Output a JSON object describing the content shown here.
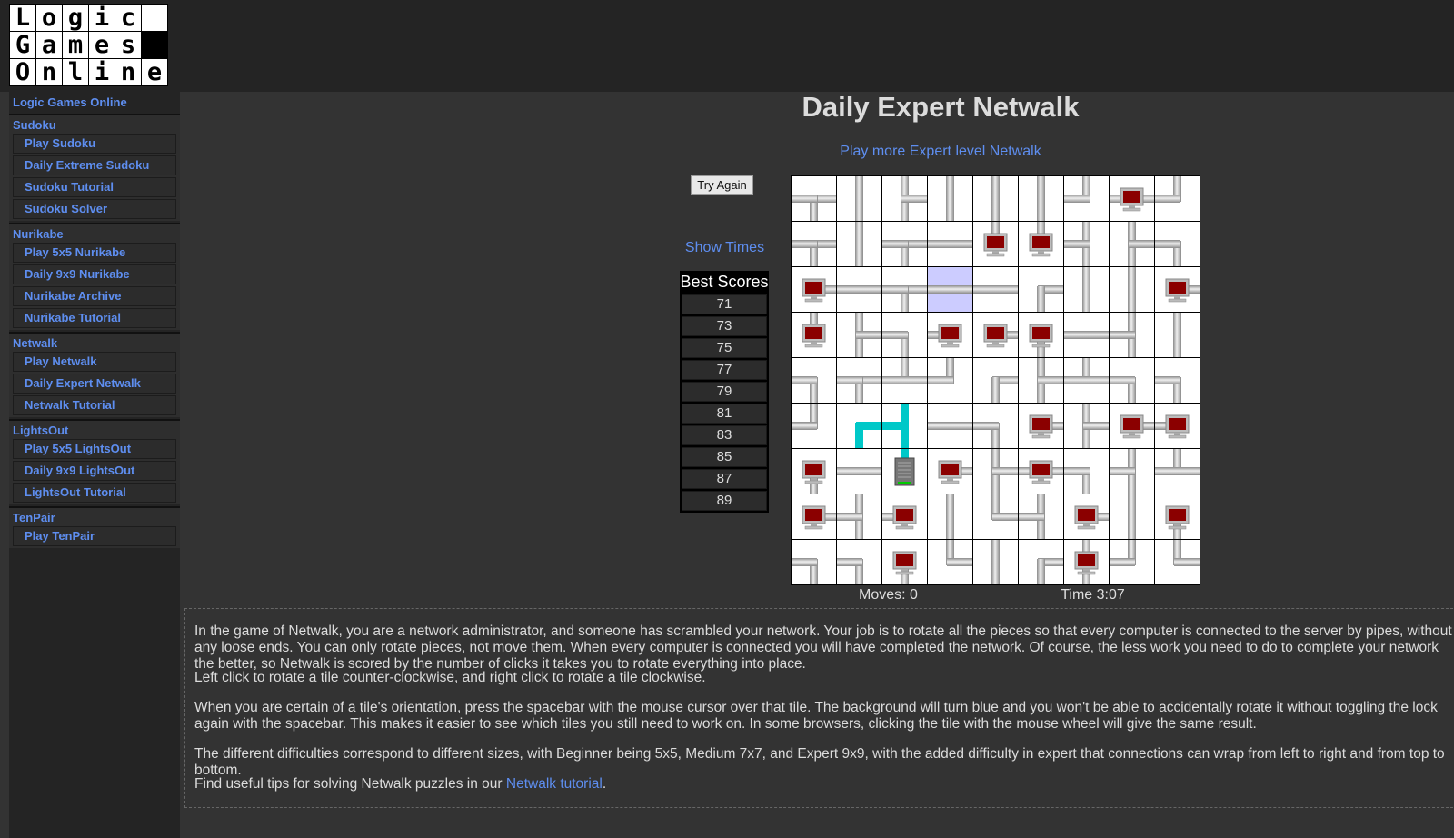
{
  "logo": {
    "rows": [
      [
        "L",
        "o",
        "g",
        "i",
        "c",
        ""
      ],
      [
        "G",
        "a",
        "m",
        "e",
        "s",
        ""
      ],
      [
        "O",
        "n",
        "l",
        "i",
        "n",
        "e"
      ]
    ]
  },
  "sidebar": {
    "home": "Logic Games Online",
    "groups": [
      {
        "title": "Sudoku",
        "items": [
          "Play Sudoku",
          "Daily Extreme Sudoku",
          "Sudoku Tutorial",
          "Sudoku Solver"
        ]
      },
      {
        "title": "Nurikabe",
        "items": [
          "Play 5x5 Nurikabe",
          "Daily 9x9 Nurikabe",
          "Nurikabe Archive",
          "Nurikabe Tutorial"
        ]
      },
      {
        "title": "Netwalk",
        "items": [
          "Play Netwalk",
          "Daily Expert Netwalk",
          "Netwalk Tutorial"
        ]
      },
      {
        "title": "LightsOut",
        "items": [
          "Play 5x5 LightsOut",
          "Daily 9x9 LightsOut",
          "LightsOut Tutorial"
        ]
      },
      {
        "title": "TenPair",
        "items": [
          "Play TenPair"
        ]
      }
    ]
  },
  "page": {
    "title": "Daily Expert Netwalk",
    "more_link": "Play more Expert level Netwalk",
    "try_again": "Try Again",
    "show_times": "Show Times"
  },
  "scores": {
    "header": "Best Scores",
    "values": [
      "71",
      "73",
      "75",
      "77",
      "79",
      "81",
      "83",
      "85",
      "87",
      "89"
    ]
  },
  "status": {
    "moves": "Moves: 0",
    "time": "Time 3:07"
  },
  "board": {
    "rows": [
      [
        "ESW",
        "NS",
        "NSE",
        "NS",
        "NS",
        "NS",
        "NW",
        "PC-EW",
        "NW"
      ],
      [
        "ESW",
        "NS",
        "ESW",
        "EW",
        "PC-N",
        "PC-N",
        "NSW",
        "NSE",
        "SW"
      ],
      [
        "PC-E",
        "EW",
        "ESW",
        "EW",
        "EW",
        "ES",
        "NS",
        "NS",
        "PC-E"
      ],
      [
        "PC-N",
        "NSE",
        "SW",
        "PC-W",
        "PC-E",
        "PC-S",
        "EW",
        "NSW",
        "NS"
      ],
      [
        "SW",
        "ESW",
        "NEW",
        "NW",
        "ES",
        "NSE",
        "NEW",
        "SW",
        "SW"
      ],
      [
        "NW",
        "ES",
        "NSW",
        "EW",
        "SW",
        "PC-E",
        "NSE",
        "PC-E",
        "PC-W"
      ],
      [
        "PC-S",
        "EW",
        "SRV-N",
        "PC-E",
        "NSE",
        "PC-EW",
        "SW",
        "NSW",
        "NEW"
      ],
      [
        "PC-E",
        "NSW",
        "PC-W",
        "NS",
        "NE",
        "NSW",
        "PC-E",
        "NS",
        "PC-S"
      ],
      [
        "SW",
        "SW",
        "PC-S",
        "NE",
        "NS",
        "ES",
        "PC-NS",
        "NW",
        "NE"
      ]
    ],
    "locked": [
      "2,3"
    ],
    "active": [
      "5,1",
      "5,2",
      "6,2"
    ],
    "pipe_color": "#b4b4b4",
    "active_color": "#00cccc",
    "computer_color": "#8b0000"
  },
  "info": {
    "p1": "In the game of Netwalk, you are a network administrator, and someone has scrambled your network. Your job is to rotate all the pieces so that every computer is connected to the server by pipes, without any loose ends. You can only rotate pieces, not move them. When every computer is connected you will have completed the network. Of course, the less work you need to do to complete your network the better, so Netwalk is scored by the number of clicks it takes you to rotate everything into place.",
    "p2": "Left click to rotate a tile counter-clockwise, and right click to rotate a tile clockwise.",
    "p3": "When you are certain of a tile's orientation, press the spacebar with the mouse cursor over that tile. The background will turn blue and you won't be able to accidentally rotate it without toggling the lock again with the spacebar. This makes it easier to see which tiles you still need to work on. In some browsers, clicking the tile with the mouse wheel will give the same result.",
    "p4": "The different difficulties correspond to different sizes, with Beginner being 5x5, Medium 7x7, and Expert 9x9, with the added difficulty in expert that connections can wrap from left to right and from top to bottom.",
    "p5_pre": "Find useful tips for solving Netwalk puzzles in our ",
    "p5_link": "Netwalk tutorial",
    "p5_post": "."
  }
}
